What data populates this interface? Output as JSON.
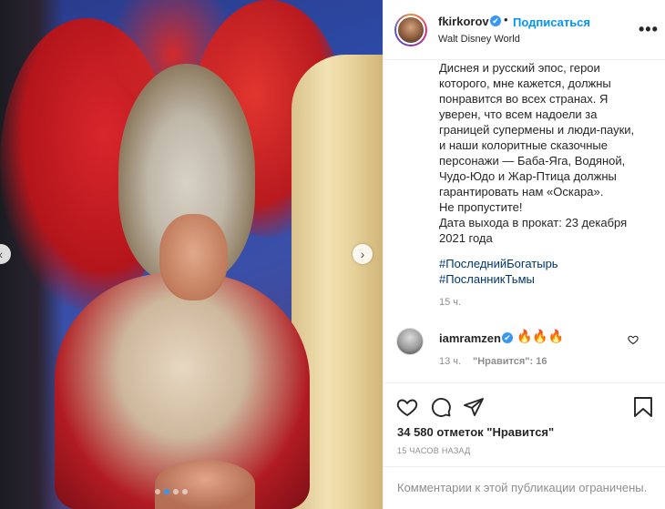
{
  "post": {
    "username": "fkirkorov",
    "separator": "•",
    "follow_label": "Подписаться",
    "location": "Walt Disney World",
    "more_label": "•••",
    "caption_lines": [
      "Диснея и русский эпос, герои",
      "которого, мне кажется, должны",
      "понравится во всех странах. Я",
      "уверен, что всем надоели за",
      "границей супермены и люди-пауки,",
      "и наши колоритные сказочные",
      "персонажи — Баба-Яга, Водяной,",
      "Чудо-Юдо и Жар-Птица должны",
      "гарантировать нам «Оскара».",
      "Не пропустите!",
      "Дата выхода в прокат: 23 декабря",
      "2021 года"
    ],
    "hashtags": [
      "#ПоследнийБогатырь",
      "#ПосланникТьмы"
    ],
    "caption_time": "15 ч.",
    "likes_text": "34 580 отметок \"Нравится\"",
    "posted_ago": "15 ЧАСОВ НАЗАД",
    "comments_restricted": "Комментарии к этой публикации ограничены."
  },
  "comment": {
    "username": "iamramzen",
    "text": "🔥🔥🔥",
    "time": "13 ч.",
    "likes": "\"Нравится\": 16"
  },
  "carousel": {
    "prev_icon": "‹",
    "next_icon": "›",
    "slides_total": 4,
    "slides_active": 2
  },
  "icons": {
    "verified": "✔",
    "heart": "heart-icon",
    "comment": "comment-icon",
    "share": "share-icon",
    "save": "bookmark-icon"
  },
  "colors": {
    "link_blue": "#0095f6",
    "verified_blue": "#3897f0",
    "hashtag": "#00376b",
    "muted": "#8e8e8e"
  }
}
